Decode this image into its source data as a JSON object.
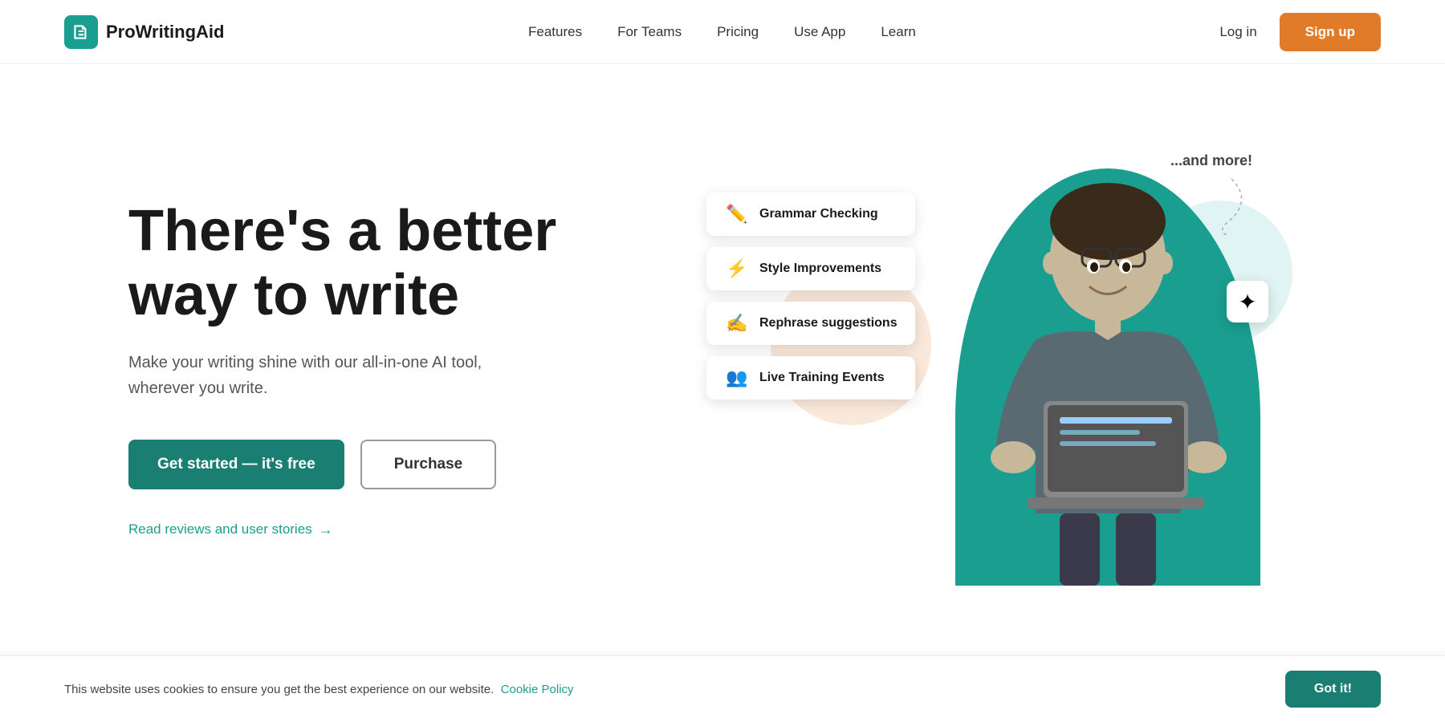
{
  "brand": {
    "name": "ProWritingAid"
  },
  "nav": {
    "links": [
      {
        "id": "features",
        "label": "Features"
      },
      {
        "id": "for-teams",
        "label": "For Teams"
      },
      {
        "id": "pricing",
        "label": "Pricing"
      },
      {
        "id": "use-app",
        "label": "Use App"
      },
      {
        "id": "learn",
        "label": "Learn"
      }
    ],
    "login_label": "Log in",
    "signup_label": "Sign up"
  },
  "hero": {
    "title_line1": "There's a better",
    "title_line2": "way to write",
    "subtitle": "Make your writing shine with our all-in-one AI tool, wherever you write.",
    "cta_primary": "Get started — it's free",
    "cta_secondary": "Purchase",
    "reviews_link": "Read reviews and user stories"
  },
  "feature_cards": [
    {
      "id": "grammar",
      "icon": "✏️",
      "label": "Grammar Checking"
    },
    {
      "id": "style",
      "icon": "⚡",
      "label": "Style Improvements"
    },
    {
      "id": "rephrase",
      "icon": "✍️",
      "label": "Rephrase suggestions"
    },
    {
      "id": "training",
      "icon": "👥",
      "label": "Live Training Events"
    }
  ],
  "and_more": "...and more!",
  "cookie": {
    "text": "This website uses cookies to ensure you get the best experience on our website.",
    "link_label": "Cookie Policy",
    "button_label": "Got it!"
  }
}
